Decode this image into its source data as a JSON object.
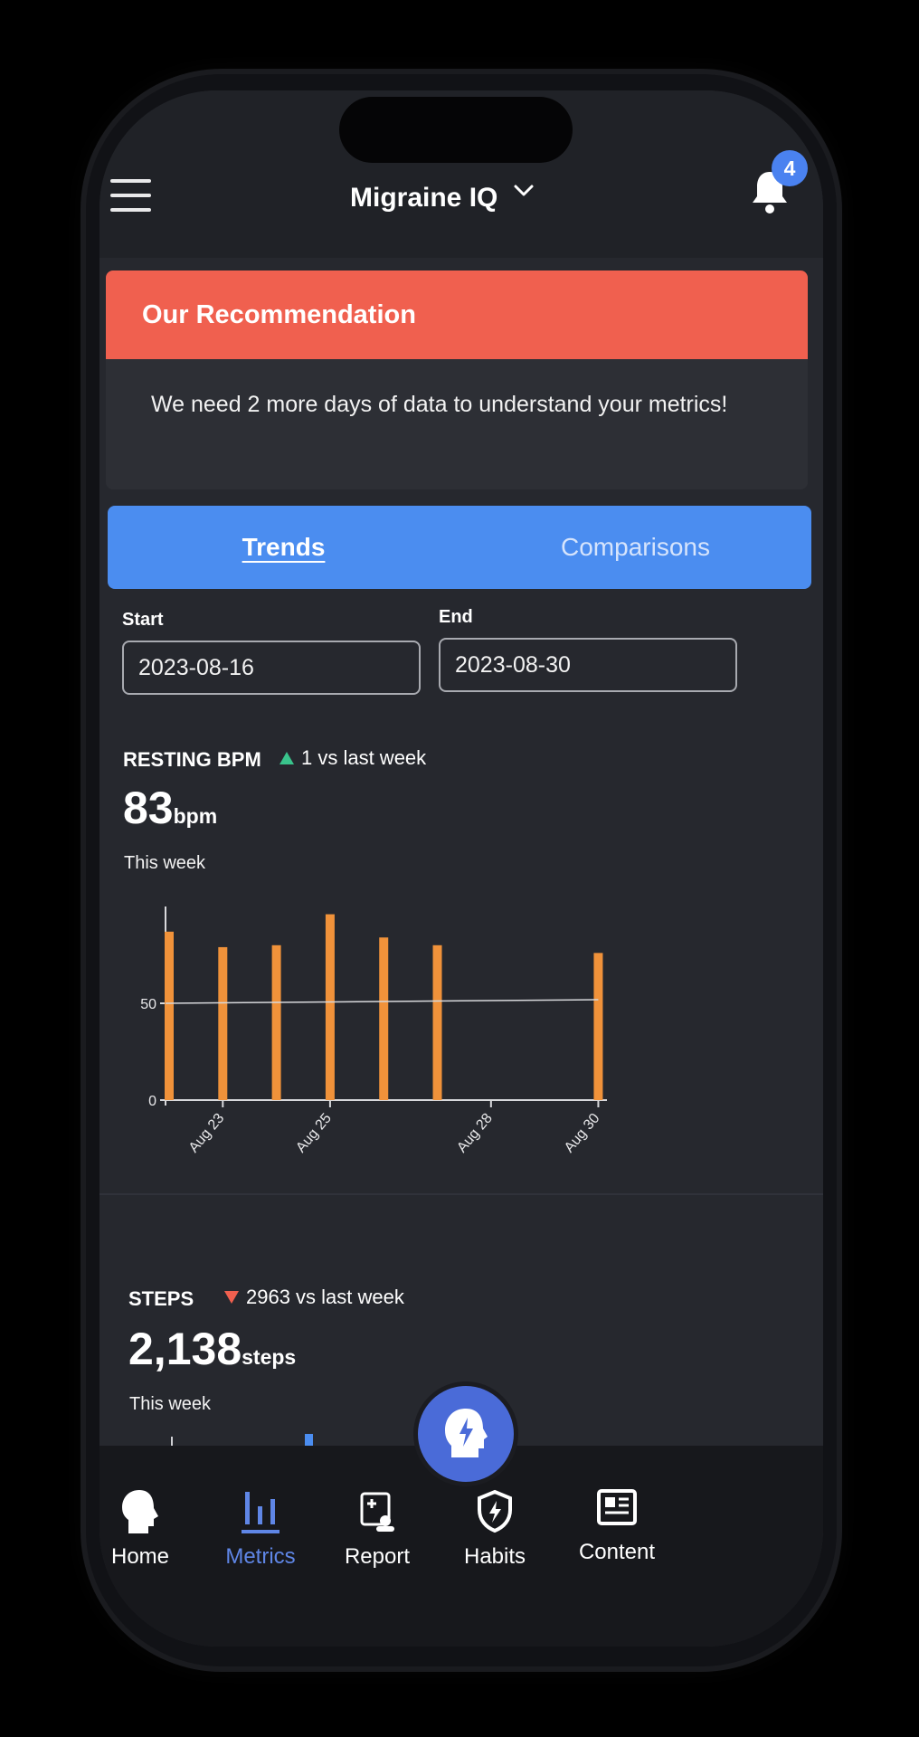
{
  "header": {
    "app_title": "Migraine IQ",
    "notification_count": "4"
  },
  "recommendation": {
    "title": "Our Recommendation",
    "body": "We need 2 more days of data to understand your metrics!"
  },
  "tabs": [
    {
      "label": "Trends",
      "active": true
    },
    {
      "label": "Comparisons",
      "active": false
    }
  ],
  "date_range": {
    "start_label": "Start",
    "start_value": "2023-08-16",
    "end_label": "End",
    "end_value": "2023-08-30"
  },
  "resting_bpm": {
    "title": "RESTING BPM",
    "delta": "1 vs last week",
    "delta_direction": "up",
    "value": "83",
    "unit": "bpm",
    "period": "This week"
  },
  "steps": {
    "title": "STEPS",
    "delta": "2963 vs last week",
    "delta_direction": "down",
    "value": "2,138",
    "unit": "steps",
    "period": "This week"
  },
  "chart_data": {
    "type": "bar",
    "x": [
      "Aug 22",
      "Aug 23",
      "Aug 24",
      "Aug 25",
      "Aug 26",
      "Aug 27",
      "Aug 28",
      "Aug 29",
      "Aug 30"
    ],
    "values": [
      87,
      79,
      80,
      96,
      84,
      80,
      null,
      null,
      76
    ],
    "tick_labels": [
      "Aug 23",
      "Aug 25",
      "Aug 28",
      "Aug 30"
    ],
    "y_ticks": [
      0,
      50
    ],
    "reference_line": 50,
    "ylim": [
      0,
      100
    ],
    "bar_color": "#f0923a"
  },
  "colors": {
    "accent_red": "#f0604f",
    "accent_blue": "#4b8df0",
    "nav_active": "#5f86e6",
    "positive": "#39c48c"
  },
  "bottom_nav": {
    "items": [
      {
        "label": "Home",
        "icon": "head-icon"
      },
      {
        "label": "Metrics",
        "icon": "bar-chart-icon",
        "active": true
      },
      {
        "label": "Report",
        "icon": "report-icon"
      },
      {
        "label": "Habits",
        "icon": "shield-bolt-icon"
      },
      {
        "label": "Content",
        "icon": "newspaper-icon"
      }
    ]
  }
}
